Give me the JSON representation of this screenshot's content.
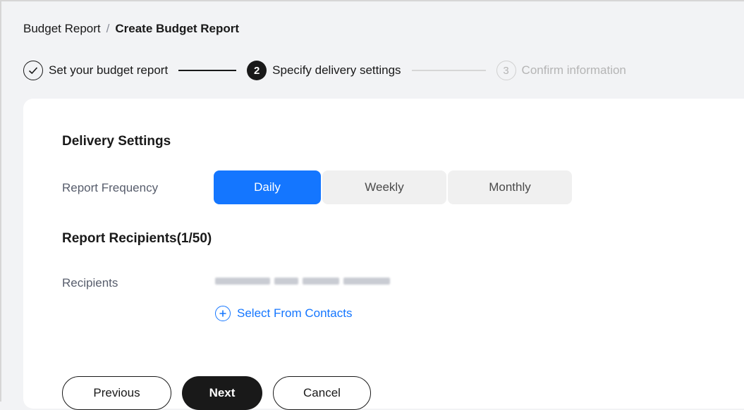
{
  "breadcrumb": {
    "root": "Budget Report",
    "separator": "/",
    "current": "Create Budget Report"
  },
  "steps": [
    {
      "number": "",
      "label": "Set your budget report",
      "state": "done"
    },
    {
      "number": "2",
      "label": "Specify delivery settings",
      "state": "active"
    },
    {
      "number": "3",
      "label": "Confirm information",
      "state": "todo"
    }
  ],
  "delivery": {
    "title": "Delivery Settings",
    "frequency_label": "Report Frequency",
    "frequency_options": [
      "Daily",
      "Weekly",
      "Monthly"
    ],
    "frequency_selected": "Daily"
  },
  "recipients": {
    "title": "Report Recipients(1/50)",
    "label": "Recipients",
    "select_label": "Select From Contacts"
  },
  "actions": {
    "previous": "Previous",
    "next": "Next",
    "cancel": "Cancel"
  },
  "colors": {
    "accent": "#1476ff",
    "primary_dark": "#191919",
    "background": "#f2f3f5"
  }
}
